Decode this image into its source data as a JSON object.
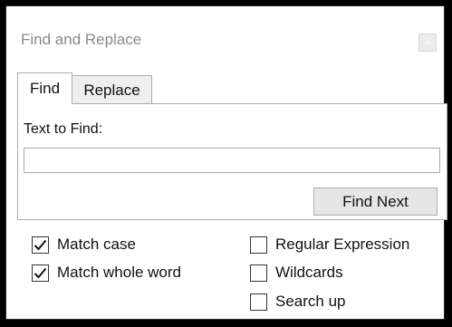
{
  "window": {
    "title": "Find and Replace",
    "close_glyph": "×"
  },
  "tabs": [
    {
      "label": "Find",
      "active": true
    },
    {
      "label": "Replace",
      "active": false
    }
  ],
  "find": {
    "label": "Text to Find:",
    "input_value": "",
    "find_next_label": "Find Next"
  },
  "options": {
    "match_case": {
      "label": "Match case",
      "checked": true
    },
    "match_whole_word": {
      "label": "Match whole word",
      "checked": true
    },
    "regular_expression": {
      "label": "Regular Expression",
      "checked": false
    },
    "wildcards": {
      "label": "Wildcards",
      "checked": false
    },
    "search_up": {
      "label": "Search up",
      "checked": false
    }
  }
}
